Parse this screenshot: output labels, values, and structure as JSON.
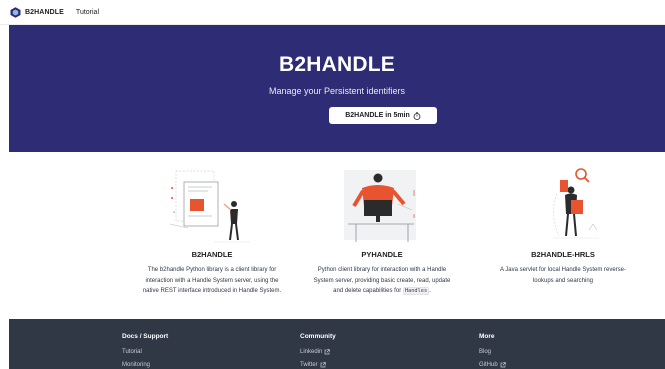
{
  "navbar": {
    "brand": "B2HANDLE",
    "links": [
      "Tutorial"
    ]
  },
  "hero": {
    "title": "B2HANDLE",
    "subtitle": "Manage your Persistent identifiers",
    "button_label": "B2HANDLE in 5min",
    "button_icon": "timer-icon"
  },
  "features": [
    {
      "title": "B2HANDLE",
      "desc_lines": [
        "The b2handle Python library is a client library for",
        "interaction with a Handle System server, using the",
        "native REST interface introduced in Handle System."
      ],
      "illustration": "document-person-illustration"
    },
    {
      "title": "PYHANDLE",
      "desc_lines": [
        "Python client library for interaction with a Handle",
        "System server, providing basic create, read, update",
        "and delete capabilities for"
      ],
      "desc_code": "Handles",
      "desc_code_suffix": ".",
      "illustration": "developer-desk-illustration"
    },
    {
      "title": "B2HANDLE-HRLS",
      "desc_lines": [
        "A Java servlet for local Handle System reverse-",
        "lookups and searching"
      ],
      "illustration": "search-person-illustration"
    }
  ],
  "footer": {
    "columns": [
      {
        "title": "Docs / Support",
        "items": [
          {
            "label": "Tutorial",
            "external": false
          },
          {
            "label": "Monitoring",
            "external": false
          }
        ]
      },
      {
        "title": "Community",
        "items": [
          {
            "label": "Linkedin",
            "external": true
          },
          {
            "label": "Twitter",
            "external": true
          }
        ]
      },
      {
        "title": "More",
        "items": [
          {
            "label": "Blog",
            "external": false
          },
          {
            "label": "GitHub",
            "external": true
          }
        ]
      }
    ]
  },
  "colors": {
    "hero_bg": "#2e2c75",
    "footer_bg": "#303846",
    "accent_orange": "#e8542f",
    "text_dark": "#1c1e21"
  }
}
